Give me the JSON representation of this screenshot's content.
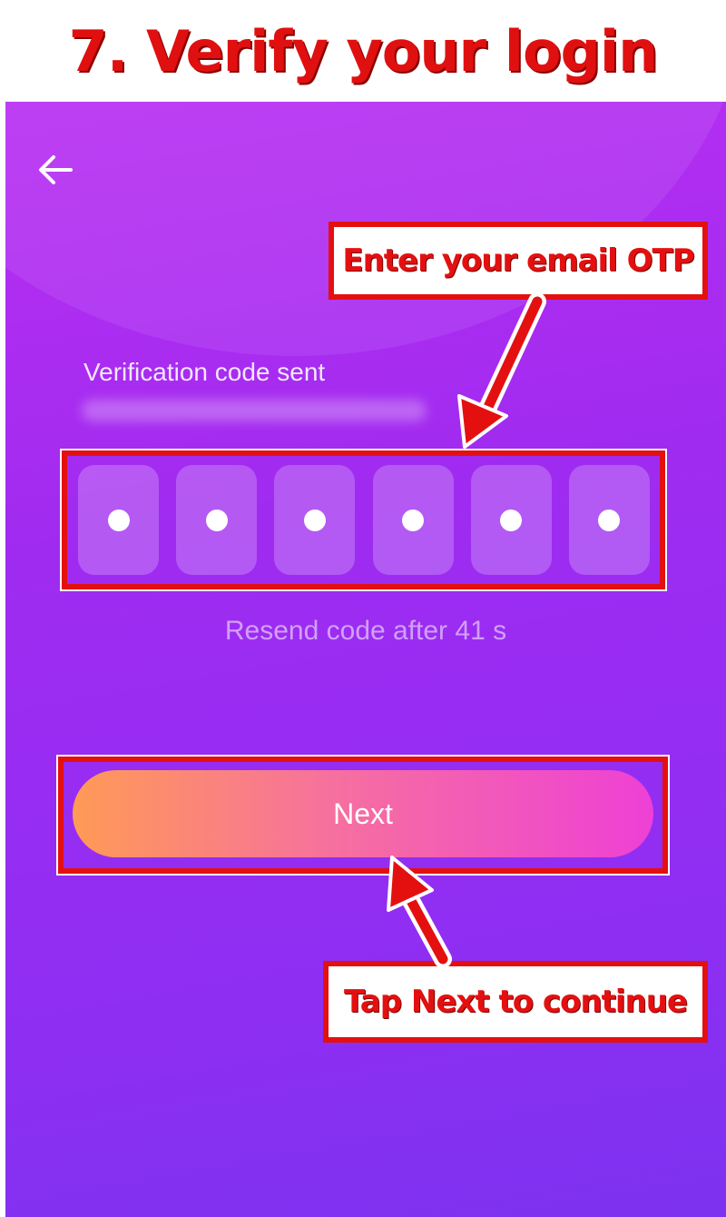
{
  "tutorial_title": "7. Verify your login",
  "screen": {
    "back_icon": "arrow-left-icon",
    "verification_label": "Verification code sent",
    "masked_email": "",
    "otp": {
      "length": 6,
      "filled": 6
    },
    "resend_text": "Resend code after 41 s",
    "next_label": "Next"
  },
  "annotations": {
    "otp_callout": "Enter your email OTP",
    "next_callout": "Tap Next to continue",
    "highlight_color": "#e41010"
  },
  "colors": {
    "screen_gradient_start": "#b92ff2",
    "screen_gradient_end": "#7c32f0",
    "button_gradient_start": "#ff9a56",
    "button_gradient_end": "#ee40d6"
  }
}
